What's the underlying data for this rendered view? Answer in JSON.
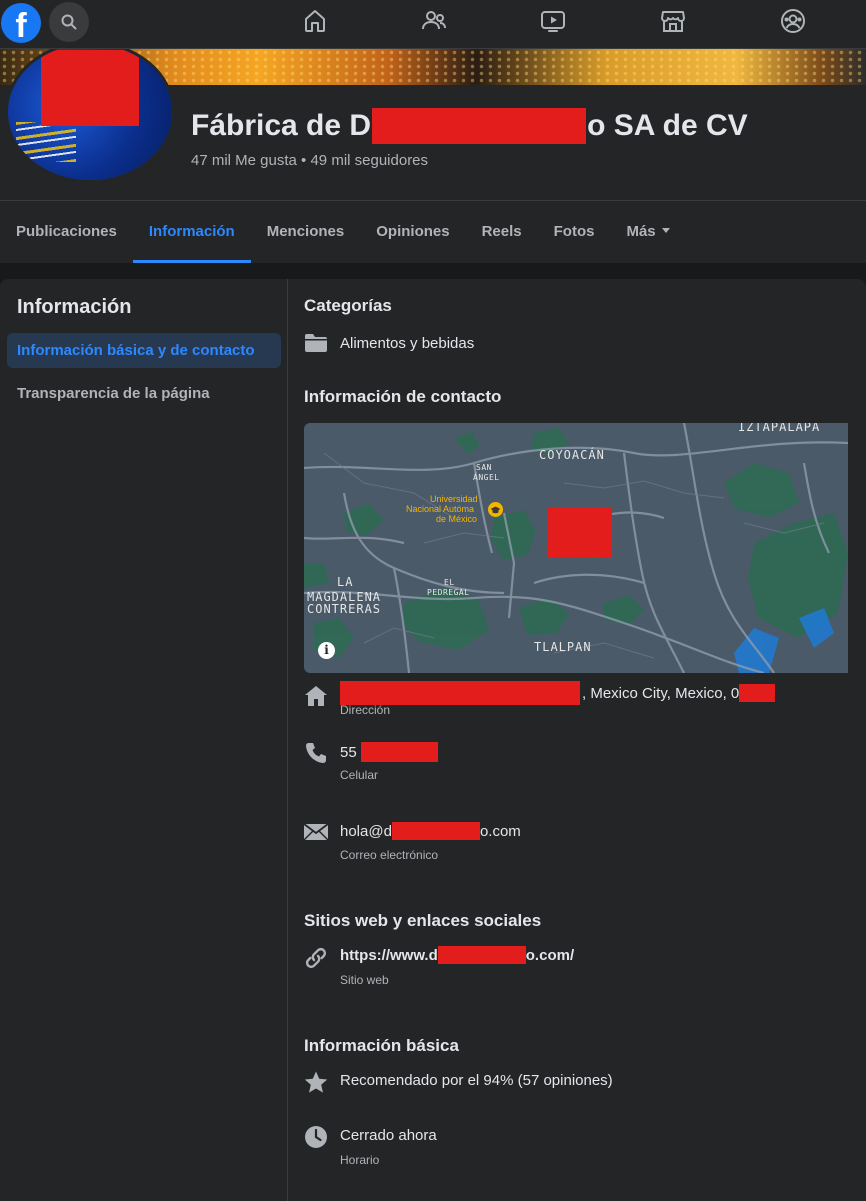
{
  "topbar": {
    "logo": "f",
    "icons": [
      "search-icon",
      "home-icon",
      "friends-icon",
      "watch-icon",
      "marketplace-icon",
      "groups-icon"
    ]
  },
  "page": {
    "title_prefix": "Fábrica de D",
    "title_suffix": "o SA de CV",
    "stats": "47 mil Me gusta • 49 mil seguidores"
  },
  "tabs": [
    {
      "label": "Publicaciones",
      "active": false
    },
    {
      "label": "Información",
      "active": true
    },
    {
      "label": "Menciones",
      "active": false
    },
    {
      "label": "Opiniones",
      "active": false
    },
    {
      "label": "Reels",
      "active": false
    },
    {
      "label": "Fotos",
      "active": false
    },
    {
      "label": "Más",
      "active": false
    }
  ],
  "sidebar": {
    "title": "Información",
    "items": [
      {
        "label": "Información básica y de contacto",
        "active": true
      },
      {
        "label": "Transparencia de la página",
        "active": false
      }
    ]
  },
  "categories": {
    "heading": "Categorías",
    "item": "Alimentos y bebidas"
  },
  "contact": {
    "heading": "Información de contacto",
    "map": {
      "labels": [
        "IZTAPALAPA",
        "COYOACÁN",
        "SAN",
        "ÁNGEL",
        "Universidad",
        "Nacional Autóma",
        "de México",
        "LA",
        "MAGDALENA",
        "CONTRERAS",
        "EL",
        "PEDREGAL",
        "TLALPAN"
      ],
      "info_glyph": "i"
    },
    "address": {
      "value_suffix": ", Mexico City, Mexico, 0",
      "label": "Dirección"
    },
    "phone": {
      "value_prefix": "55",
      "label": "Celular"
    },
    "email": {
      "value_prefix": "hola@d",
      "value_suffix": "o.com",
      "label": "Correo electrónico"
    }
  },
  "websites": {
    "heading": "Sitios web y enlaces sociales",
    "url_prefix": "https://www.d",
    "url_suffix": "o.com/",
    "label": "Sitio web"
  },
  "basic": {
    "heading": "Información básica",
    "rating": "Recomendado por el 94% (57 opiniones)",
    "hours": "Cerrado ahora",
    "hours_label": "Horario"
  },
  "colors": {
    "background": "#18191a",
    "surface": "#242526",
    "accent": "#2d88ff",
    "redaction": "#e31c1c",
    "text_primary": "#e4e6eb",
    "text_secondary": "#b0b3b8"
  }
}
